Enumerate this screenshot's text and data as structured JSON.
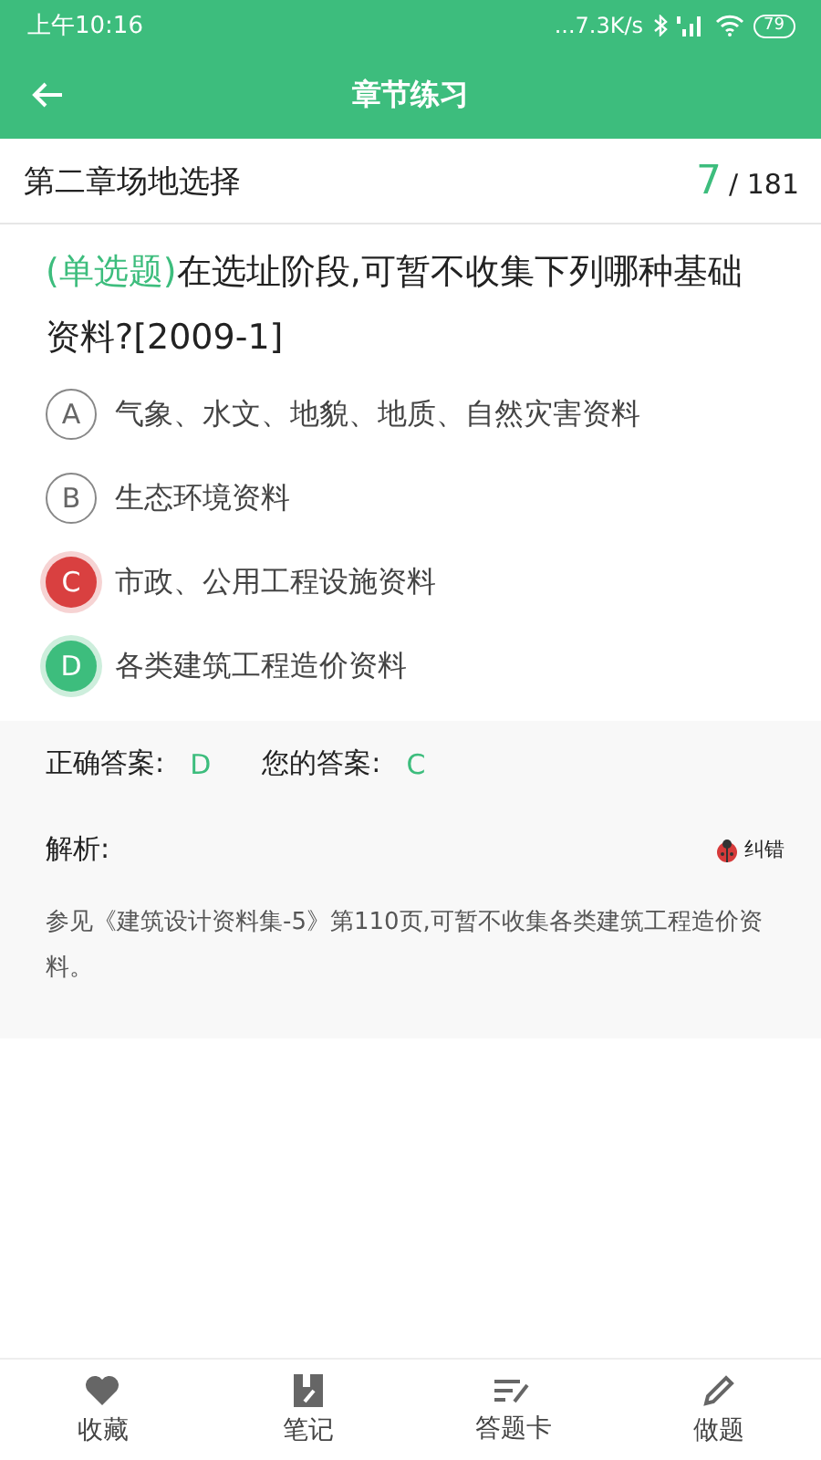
{
  "status_bar": {
    "time": "上午10:16",
    "speed": "...7.3K/s",
    "battery": "79"
  },
  "header": {
    "title": "章节练习"
  },
  "chapter": {
    "title": "第二章场地选择",
    "current": "7",
    "total": "/ 181"
  },
  "question": {
    "type_label": "(单选题)",
    "text": "在选址阶段,可暂不收集下列哪种基础资料?[2009-1]"
  },
  "options": [
    {
      "letter": "A",
      "text": "气象、水文、地貌、地质、自然灾害资料",
      "kind": "plain"
    },
    {
      "letter": "B",
      "text": "生态环境资料",
      "kind": "plain"
    },
    {
      "letter": "C",
      "text": "市政、公用工程设施资料",
      "kind": "wrong"
    },
    {
      "letter": "D",
      "text": "各类建筑工程造价资料",
      "kind": "correct"
    }
  ],
  "answer": {
    "correct_label": "正确答案:",
    "correct": "D",
    "yours_label": "您的答案:",
    "yours": "C"
  },
  "analysis": {
    "label": "解析:",
    "report": "纠错",
    "text": "参见《建筑设计资料集-5》第110页,可暂不收集各类建筑工程造价资料。"
  },
  "bottom_nav": [
    {
      "label": "收藏"
    },
    {
      "label": "笔记"
    },
    {
      "label": "答题卡"
    },
    {
      "label": "做题"
    }
  ]
}
